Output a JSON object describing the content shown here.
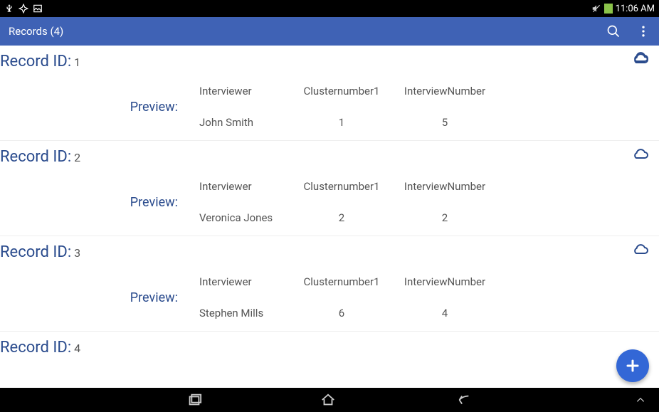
{
  "status": {
    "time": "11:06 AM"
  },
  "appbar": {
    "title": "Records (4)"
  },
  "labels": {
    "record_id": "Record ID:",
    "preview": "Preview:",
    "headers": {
      "interviewer": "Interviewer",
      "cluster": "Clusternumber1",
      "interviewnum": "InterviewNumber"
    }
  },
  "records": [
    {
      "id": "1",
      "interviewer": "John Smith",
      "cluster": "1",
      "interviewnum": "5"
    },
    {
      "id": "2",
      "interviewer": "Veronica Jones",
      "cluster": "2",
      "interviewnum": "2"
    },
    {
      "id": "3",
      "interviewer": "Stephen Mills",
      "cluster": "6",
      "interviewnum": "4"
    },
    {
      "id": "4",
      "interviewer": "",
      "cluster": "",
      "interviewnum": ""
    }
  ]
}
